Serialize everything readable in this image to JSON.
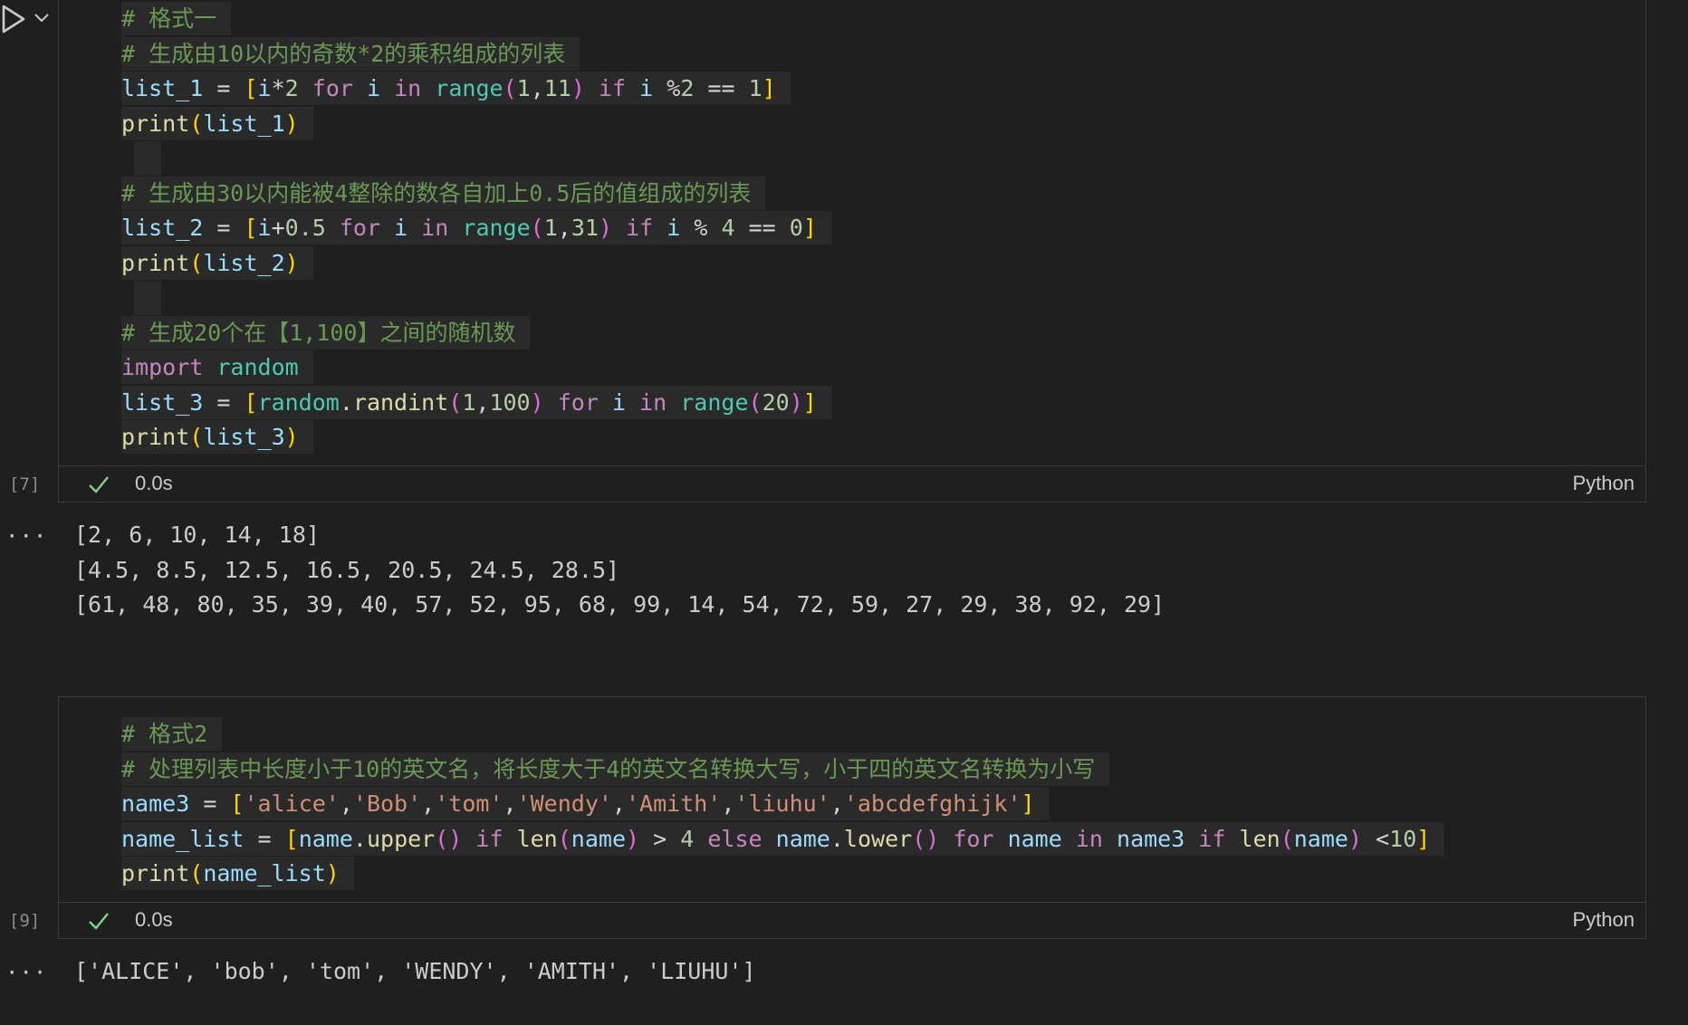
{
  "cell1": {
    "exec_count": "[7]",
    "time": "0.0s",
    "language": "Python",
    "lines": [
      [
        {
          "t": "# 格式一",
          "c": "com"
        }
      ],
      [
        {
          "t": "# 生成由10以内的奇数*2的乘积组成的列表",
          "c": "com"
        }
      ],
      [
        {
          "t": "list_1",
          "c": "var"
        },
        {
          "t": " = ",
          "c": "op"
        },
        {
          "t": "[",
          "c": "b1"
        },
        {
          "t": "i",
          "c": "var"
        },
        {
          "t": "*",
          "c": "op"
        },
        {
          "t": "2",
          "c": "num"
        },
        {
          "t": " ",
          "c": "op"
        },
        {
          "t": "for",
          "c": "kw"
        },
        {
          "t": " ",
          "c": "op"
        },
        {
          "t": "i",
          "c": "var"
        },
        {
          "t": " ",
          "c": "op"
        },
        {
          "t": "in",
          "c": "kw"
        },
        {
          "t": " ",
          "c": "op"
        },
        {
          "t": "range",
          "c": "cls"
        },
        {
          "t": "(",
          "c": "b2"
        },
        {
          "t": "1",
          "c": "num"
        },
        {
          "t": ",",
          "c": "op"
        },
        {
          "t": "11",
          "c": "num"
        },
        {
          "t": ")",
          "c": "b2"
        },
        {
          "t": " ",
          "c": "op"
        },
        {
          "t": "if",
          "c": "kw"
        },
        {
          "t": " ",
          "c": "op"
        },
        {
          "t": "i",
          "c": "var"
        },
        {
          "t": " %",
          "c": "op"
        },
        {
          "t": "2",
          "c": "num"
        },
        {
          "t": " == ",
          "c": "op"
        },
        {
          "t": "1",
          "c": "num"
        },
        {
          "t": "]",
          "c": "b1"
        }
      ],
      [
        {
          "t": "print",
          "c": "fn"
        },
        {
          "t": "(",
          "c": "b1"
        },
        {
          "t": "list_1",
          "c": "var"
        },
        {
          "t": ")",
          "c": "b1"
        }
      ],
      [],
      [
        {
          "t": "# 生成由30以内能被4整除的数各自加上0.5后的值组成的列表",
          "c": "com"
        }
      ],
      [
        {
          "t": "list_2",
          "c": "var"
        },
        {
          "t": " = ",
          "c": "op"
        },
        {
          "t": "[",
          "c": "b1"
        },
        {
          "t": "i",
          "c": "var"
        },
        {
          "t": "+",
          "c": "op"
        },
        {
          "t": "0.5",
          "c": "num"
        },
        {
          "t": " ",
          "c": "op"
        },
        {
          "t": "for",
          "c": "kw"
        },
        {
          "t": " ",
          "c": "op"
        },
        {
          "t": "i",
          "c": "var"
        },
        {
          "t": " ",
          "c": "op"
        },
        {
          "t": "in",
          "c": "kw"
        },
        {
          "t": " ",
          "c": "op"
        },
        {
          "t": "range",
          "c": "cls"
        },
        {
          "t": "(",
          "c": "b2"
        },
        {
          "t": "1",
          "c": "num"
        },
        {
          "t": ",",
          "c": "op"
        },
        {
          "t": "31",
          "c": "num"
        },
        {
          "t": ")",
          "c": "b2"
        },
        {
          "t": " ",
          "c": "op"
        },
        {
          "t": "if",
          "c": "kw"
        },
        {
          "t": " ",
          "c": "op"
        },
        {
          "t": "i",
          "c": "var"
        },
        {
          "t": " % ",
          "c": "op"
        },
        {
          "t": "4",
          "c": "num"
        },
        {
          "t": " == ",
          "c": "op"
        },
        {
          "t": "0",
          "c": "num"
        },
        {
          "t": "]",
          "c": "b1"
        }
      ],
      [
        {
          "t": "print",
          "c": "fn"
        },
        {
          "t": "(",
          "c": "b1"
        },
        {
          "t": "list_2",
          "c": "var"
        },
        {
          "t": ")",
          "c": "b1"
        }
      ],
      [],
      [
        {
          "t": "# 生成20个在【1,100】之间的随机数",
          "c": "com"
        }
      ],
      [
        {
          "t": "import",
          "c": "kw"
        },
        {
          "t": " ",
          "c": "op"
        },
        {
          "t": "random",
          "c": "cls"
        }
      ],
      [
        {
          "t": "list_3",
          "c": "var"
        },
        {
          "t": " = ",
          "c": "op"
        },
        {
          "t": "[",
          "c": "b1"
        },
        {
          "t": "random",
          "c": "cls"
        },
        {
          "t": ".",
          "c": "op"
        },
        {
          "t": "randint",
          "c": "fn"
        },
        {
          "t": "(",
          "c": "b2"
        },
        {
          "t": "1",
          "c": "num"
        },
        {
          "t": ",",
          "c": "op"
        },
        {
          "t": "100",
          "c": "num"
        },
        {
          "t": ")",
          "c": "b2"
        },
        {
          "t": " ",
          "c": "op"
        },
        {
          "t": "for",
          "c": "kw"
        },
        {
          "t": " ",
          "c": "op"
        },
        {
          "t": "i",
          "c": "var"
        },
        {
          "t": " ",
          "c": "op"
        },
        {
          "t": "in",
          "c": "kw"
        },
        {
          "t": " ",
          "c": "op"
        },
        {
          "t": "range",
          "c": "cls"
        },
        {
          "t": "(",
          "c": "b2"
        },
        {
          "t": "20",
          "c": "num"
        },
        {
          "t": ")",
          "c": "b2"
        },
        {
          "t": "]",
          "c": "b1"
        }
      ],
      [
        {
          "t": "print",
          "c": "fn"
        },
        {
          "t": "(",
          "c": "b1"
        },
        {
          "t": "list_3",
          "c": "var"
        },
        {
          "t": ")",
          "c": "b1"
        }
      ]
    ],
    "output": [
      "[2, 6, 10, 14, 18]",
      "[4.5, 8.5, 12.5, 16.5, 20.5, 24.5, 28.5]",
      "[61, 48, 80, 35, 39, 40, 57, 52, 95, 68, 99, 14, 54, 72, 59, 27, 29, 38, 92, 29]"
    ]
  },
  "cell2": {
    "exec_count": "[9]",
    "time": "0.0s",
    "language": "Python",
    "lines": [
      [
        {
          "t": "# 格式2",
          "c": "com"
        }
      ],
      [
        {
          "t": "# 处理列表中长度小于10的英文名，将长度大于4的英文名转换大写，小于四的英文名转换为小写",
          "c": "com"
        }
      ],
      [
        {
          "t": "name3",
          "c": "var"
        },
        {
          "t": " = ",
          "c": "op"
        },
        {
          "t": "[",
          "c": "b1"
        },
        {
          "t": "'alice'",
          "c": "str"
        },
        {
          "t": ",",
          "c": "op"
        },
        {
          "t": "'Bob'",
          "c": "str"
        },
        {
          "t": ",",
          "c": "op"
        },
        {
          "t": "'tom'",
          "c": "str"
        },
        {
          "t": ",",
          "c": "op"
        },
        {
          "t": "'Wendy'",
          "c": "str"
        },
        {
          "t": ",",
          "c": "op"
        },
        {
          "t": "'Amith'",
          "c": "str"
        },
        {
          "t": ",",
          "c": "op"
        },
        {
          "t": "'liuhu'",
          "c": "str"
        },
        {
          "t": ",",
          "c": "op"
        },
        {
          "t": "'abcdefghijk'",
          "c": "str"
        },
        {
          "t": "]",
          "c": "b1"
        }
      ],
      [
        {
          "t": "name_list",
          "c": "var"
        },
        {
          "t": " = ",
          "c": "op"
        },
        {
          "t": "[",
          "c": "b1"
        },
        {
          "t": "name",
          "c": "var"
        },
        {
          "t": ".",
          "c": "op"
        },
        {
          "t": "upper",
          "c": "fn"
        },
        {
          "t": "()",
          "c": "b2"
        },
        {
          "t": " ",
          "c": "op"
        },
        {
          "t": "if",
          "c": "kw"
        },
        {
          "t": " ",
          "c": "op"
        },
        {
          "t": "len",
          "c": "fn"
        },
        {
          "t": "(",
          "c": "b2"
        },
        {
          "t": "name",
          "c": "var"
        },
        {
          "t": ")",
          "c": "b2"
        },
        {
          "t": " > ",
          "c": "op"
        },
        {
          "t": "4",
          "c": "num"
        },
        {
          "t": " ",
          "c": "op"
        },
        {
          "t": "else",
          "c": "kw"
        },
        {
          "t": " ",
          "c": "op"
        },
        {
          "t": "name",
          "c": "var"
        },
        {
          "t": ".",
          "c": "op"
        },
        {
          "t": "lower",
          "c": "fn"
        },
        {
          "t": "()",
          "c": "b2"
        },
        {
          "t": " ",
          "c": "op"
        },
        {
          "t": "for",
          "c": "kw"
        },
        {
          "t": " ",
          "c": "op"
        },
        {
          "t": "name",
          "c": "var"
        },
        {
          "t": " ",
          "c": "op"
        },
        {
          "t": "in",
          "c": "kw"
        },
        {
          "t": " ",
          "c": "op"
        },
        {
          "t": "name3",
          "c": "var"
        },
        {
          "t": " ",
          "c": "op"
        },
        {
          "t": "if",
          "c": "kw"
        },
        {
          "t": " ",
          "c": "op"
        },
        {
          "t": "len",
          "c": "fn"
        },
        {
          "t": "(",
          "c": "b2"
        },
        {
          "t": "name",
          "c": "var"
        },
        {
          "t": ")",
          "c": "b2"
        },
        {
          "t": " <",
          "c": "op"
        },
        {
          "t": "10",
          "c": "num"
        },
        {
          "t": "]",
          "c": "b1"
        }
      ],
      [
        {
          "t": "print",
          "c": "fn"
        },
        {
          "t": "(",
          "c": "b1"
        },
        {
          "t": "name_list",
          "c": "var"
        },
        {
          "t": ")",
          "c": "b1"
        }
      ]
    ],
    "output": [
      "['ALICE', 'bob', 'tom', 'WENDY', 'AMITH', 'LIUHU']"
    ]
  },
  "toolbar": {
    "run_icon": "run-icon",
    "more_icon": "chevron-down-icon",
    "output_more": "···"
  },
  "colors": {
    "background": "#1f1f1f",
    "line_highlight": "#2a2a2a",
    "success_check": "#89d185"
  }
}
